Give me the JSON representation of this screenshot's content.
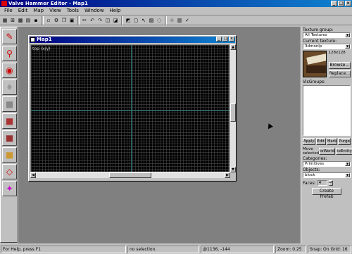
{
  "app": {
    "title": "Valve Hammer Editor - Map1"
  },
  "menu": {
    "items": [
      "File",
      "Edit",
      "Map",
      "View",
      "Tools",
      "Window",
      "Help"
    ]
  },
  "toolbar": {
    "groups": [
      [
        "grid-icon",
        "grid-toggle-icon",
        "3d-grid-icon",
        "map-view-icon",
        "save-icon"
      ],
      [
        "open-icon",
        "compile-icon",
        "copy-icon",
        "paste-icon"
      ],
      [
        "cut-icon",
        "undo-icon",
        "redo-icon",
        "group-icon",
        "ungroup-icon"
      ],
      [
        "carve-icon",
        "hollow-icon",
        "select-icon",
        "texture-lock-icon",
        "hide-icon"
      ],
      [
        "snap-icon",
        "entity-report-icon",
        "prefab-icon"
      ]
    ]
  },
  "tools": [
    {
      "name": "selection-tool",
      "glyph": "✎",
      "color": "#c00"
    },
    {
      "name": "magnify-tool",
      "glyph": "⚲",
      "color": "#c00"
    },
    {
      "name": "camera-tool",
      "glyph": "◉",
      "color": "#c00"
    },
    {
      "name": "entity-tool",
      "glyph": "♦",
      "color": "#999"
    },
    {
      "name": "block-tool",
      "glyph": "■",
      "color": "#888"
    },
    {
      "name": "texture-tool",
      "glyph": "■",
      "color": "#a33"
    },
    {
      "name": "apply-texture-tool",
      "glyph": "■",
      "color": "#933"
    },
    {
      "name": "decal-tool",
      "glyph": "■",
      "color": "#c93"
    },
    {
      "name": "clip-tool",
      "glyph": "◇",
      "color": "#c00"
    },
    {
      "name": "vertex-tool",
      "glyph": "✦",
      "color": "#c0c"
    }
  ],
  "map_window": {
    "title": "Map1",
    "view_label": "top (x/y)"
  },
  "panel": {
    "texture_group_label": "Texture group:",
    "texture_group_value": "All Textures",
    "current_texture_label": "Current texture:",
    "current_texture_value": "3dmonlp",
    "texture_size": "128x128",
    "browse_label": "Browse...",
    "replace_label": "Replace...",
    "visgroups_label": "VisGroups:",
    "visgroup_buttons": [
      "Apply",
      "Edit",
      "Mark",
      "Purge"
    ],
    "move_selected_label": "Move selected:",
    "to_world_label": "toWorld",
    "to_entity_label": "toEntity",
    "categories_label": "Categories:",
    "categories_value": "Primitives",
    "objects_label": "Objects:",
    "objects_value": "block",
    "faces_label": "Faces:",
    "faces_value": "4",
    "create_prefab_label": "Create Prefab"
  },
  "status": {
    "help": "For Help, press F1",
    "selection": "no selection.",
    "coords": "@1136, -144",
    "zoom": "Zoom: 0.25",
    "snap": "Snap: On Grid: 16"
  },
  "colors": {
    "title_start": "#000080",
    "title_end": "#1084d0",
    "viewport_bg": "#000000",
    "axis": "#2a7a7a"
  }
}
